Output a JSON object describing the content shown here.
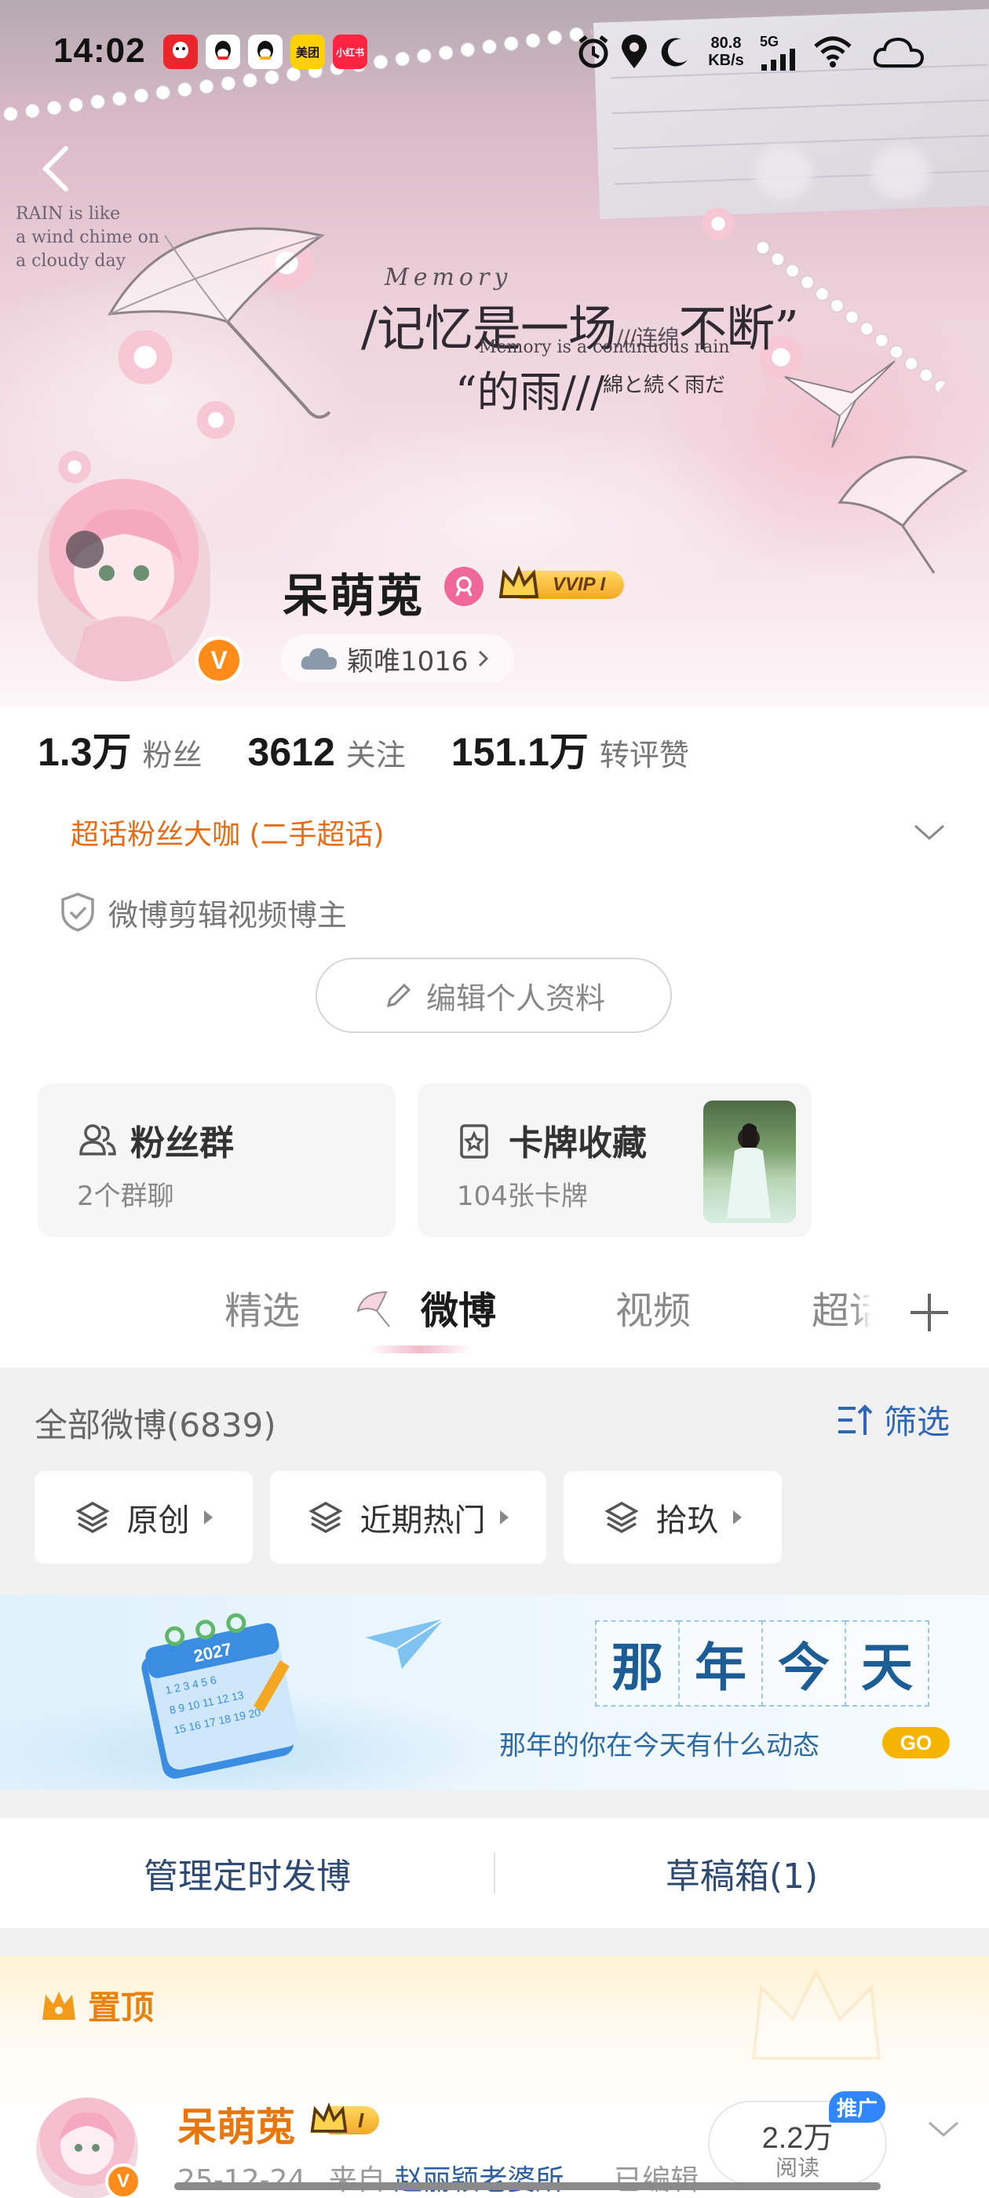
{
  "status_bar": {
    "time": "14:02",
    "app_icons": [
      {
        "name": "qq-red",
        "label": "",
        "color": "#e8262b"
      },
      {
        "name": "qq",
        "label": "",
        "color": "#ffffff"
      },
      {
        "name": "qq2",
        "label": "",
        "color": "#ffffff"
      },
      {
        "name": "meituan",
        "label": "美团",
        "color": "#ffd100"
      },
      {
        "name": "xiaohongshu",
        "label": "小红书",
        "color": "#ff2442"
      }
    ],
    "net_speed_value": "80.8",
    "net_speed_unit": "KB/s",
    "network_type": "5G"
  },
  "header": {
    "banner_corner_text": [
      "RAIN is like",
      "a wind chime on",
      "a cloudy day"
    ],
    "banner_memory": "Memory",
    "banner_line1": "/记忆是一场",
    "banner_line1_mid": "///连绵",
    "banner_line1_end": "不断”",
    "banner_line1_sub": "Memory is a continuous rain",
    "banner_line2": "“的雨///",
    "banner_line2_jp": "綿と続く雨だ"
  },
  "profile": {
    "username": "呆萌莵",
    "vip_label": "VVIP I",
    "ip_location": "颖唯1016",
    "stats": [
      {
        "value": "1.3万",
        "label": "粉丝"
      },
      {
        "value": "3612",
        "label": "关注"
      },
      {
        "value": "151.1万",
        "label": "转评赞"
      }
    ],
    "super_topic": "超话粉丝大咖 (二手超话)",
    "certification": "微博剪辑视频博主",
    "edit_profile": "编辑个人资料"
  },
  "cards": {
    "fan_group": {
      "title": "粉丝群",
      "subtitle": "2个群聊"
    },
    "card_collection": {
      "title": "卡牌收藏",
      "subtitle": "104张卡牌"
    }
  },
  "tabs": [
    {
      "label": "精选",
      "active": false
    },
    {
      "label": "微博",
      "active": true
    },
    {
      "label": "视频",
      "active": false
    },
    {
      "label": "超话",
      "active": false
    }
  ],
  "feed_filter": {
    "all_label": "全部微博(6839)",
    "filter_label": "筛选",
    "chips": [
      "原创",
      "近期热门",
      "拾玖"
    ]
  },
  "anniversary_banner": {
    "calendar_year": "2027",
    "title_chars": [
      "那",
      "年",
      "今",
      "天"
    ],
    "subtitle": "那年的你在今天有什么动态",
    "go_label": "GO"
  },
  "manage": {
    "scheduled": "管理定时发博",
    "drafts": "草稿箱(1)"
  },
  "pinned_post": {
    "pinned_label": "置顶",
    "username": "呆萌莵",
    "vip_label": "I",
    "date": "25-12-24",
    "source_prefix": "来自",
    "source": "赵丽颖老婆所...",
    "edited": "已编辑",
    "read_count": "2.2万",
    "read_label": "阅读",
    "promo_badge": "推广"
  },
  "colors": {
    "accent_orange": "#e66d16",
    "link_blue": "#2f67b6",
    "verified_orange": "#ff8c1a",
    "vip_gold": "#f3a826"
  }
}
